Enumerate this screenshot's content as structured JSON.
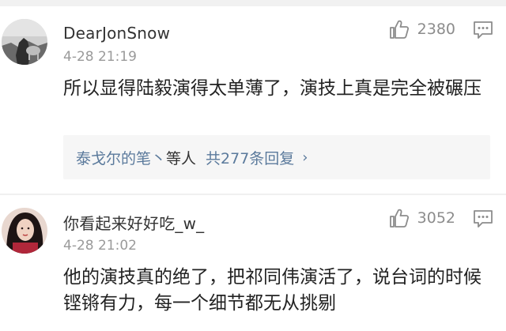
{
  "comments": [
    {
      "username": "DearJonSnow",
      "time": "4-28 21:19",
      "like_count": "2380",
      "text": "所以显得陆毅演得太单薄了，演技上真是完全被碾压",
      "replies": {
        "user": "泰戈尔的笔丶",
        "connector": "等人",
        "total": "共277条回复",
        "chevron": "›"
      },
      "icons": {
        "like": "thumbs-up-icon",
        "reply": "comment-icon"
      }
    },
    {
      "username": "你看起来好好吃_w_",
      "time": "4-28 21:02",
      "like_count": "3052",
      "text": "他的演技真的绝了，把祁同伟演活了，说台词的时候铿锵有力，每一个细节都无从挑剔",
      "icons": {
        "like": "thumbs-up-icon",
        "reply": "comment-icon"
      }
    }
  ],
  "colors": {
    "link": "#5b7a9c",
    "meta": "#9a9a9a",
    "count": "#8c8c8c"
  }
}
